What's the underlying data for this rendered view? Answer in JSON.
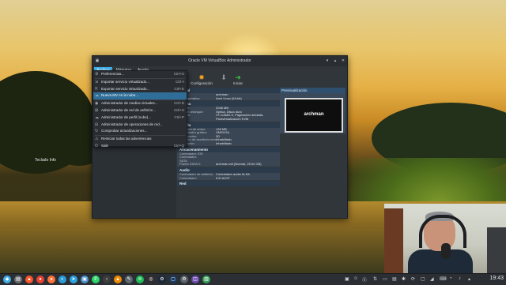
{
  "window": {
    "title": "Oracle VM VirtualBox Administrador"
  },
  "menubar": {
    "items": [
      "Archivo",
      "Máquina",
      "Ayuda"
    ]
  },
  "toolbar": {
    "settings_label": "Configuración",
    "start_label": "Iniciar"
  },
  "file_menu": {
    "items": [
      {
        "label": "Preferencias...",
        "shortcut": "Ctrl+G"
      },
      {
        "label": "Importar servicio virtualizado...",
        "shortcut": "Ctrl+I"
      },
      {
        "label": "Exportar servicio virtualizado...",
        "shortcut": "Ctrl+E"
      },
      {
        "label": "Nueva MV en la nube...",
        "shortcut": ""
      },
      {
        "label": "Administrador de medios virtuales...",
        "shortcut": "Ctrl+D"
      },
      {
        "label": "Administrador de red de anfitrión...",
        "shortcut": "Ctrl+H"
      },
      {
        "label": "Administrador de perfil (nube)...",
        "shortcut": "Ctrl+P"
      },
      {
        "label": "Administrador de operaciones de red...",
        "shortcut": ""
      },
      {
        "label": "Comprobar actualizaciones...",
        "shortcut": ""
      },
      {
        "label": "Reiniciar todas las advertencias",
        "shortcut": ""
      },
      {
        "label": "Salir",
        "shortcut": "Ctrl+Q"
      }
    ]
  },
  "details": {
    "general": {
      "header": "eneral",
      "rows": [
        {
          "k": "e:",
          "v": "archman"
        },
        {
          "k": "a de operativo:",
          "v": "Arch Linux (64-bit)"
        }
      ]
    },
    "system": {
      "header": "istema",
      "rows": [
        {
          "k": "a base:",
          "v": "2048 MB"
        },
        {
          "k": "den de arranque:",
          "v": "Óptica, Disco duro"
        },
        {
          "k": "eración:",
          "v": "VT-x/AMD-V, Paginación anidada,"
        },
        {
          "k": "",
          "v": "Paravirtualización KVM"
        }
      ]
    },
    "display": {
      "header": "antalla",
      "rows": [
        {
          "k": "Memoria de vídeo:",
          "v": "128 MB"
        },
        {
          "k": "Controlador gráfico:",
          "v": "VMSVGA"
        },
        {
          "k": "Aceleración:",
          "v": "3D"
        },
        {
          "k": "Servidor de escritorio remoto:",
          "v": "Inhabilitado"
        },
        {
          "k": "Grabación:",
          "v": "Inhabilitado"
        }
      ]
    },
    "storage": {
      "header": "Almacenamiento",
      "rows": [
        {
          "k": "Controlador: IDE",
          "v": ""
        },
        {
          "k": "Controlador:",
          "v": ""
        },
        {
          "k": "SATA",
          "v": ""
        },
        {
          "k": "Puerto SATA 0:",
          "v": "archman.vdi (Normal, 25 64 GB)"
        }
      ]
    },
    "audio": {
      "header": "Audio",
      "rows": [
        {
          "k": "Controlador de anfitrión:",
          "v": "Controlador audio ALSA"
        },
        {
          "k": "Controlador:",
          "v": "ICH AC97"
        }
      ]
    },
    "network": {
      "header": "Red"
    }
  },
  "preview": {
    "header": "Previsualización",
    "vm_name": "archman"
  },
  "desktop": {
    "label": "Teclado Info"
  },
  "taskbar": {
    "clock": "19:43"
  },
  "icons": {
    "settings": "gear-icon",
    "discard": "down-arrow-icon",
    "start": "green-arrow-icon"
  }
}
